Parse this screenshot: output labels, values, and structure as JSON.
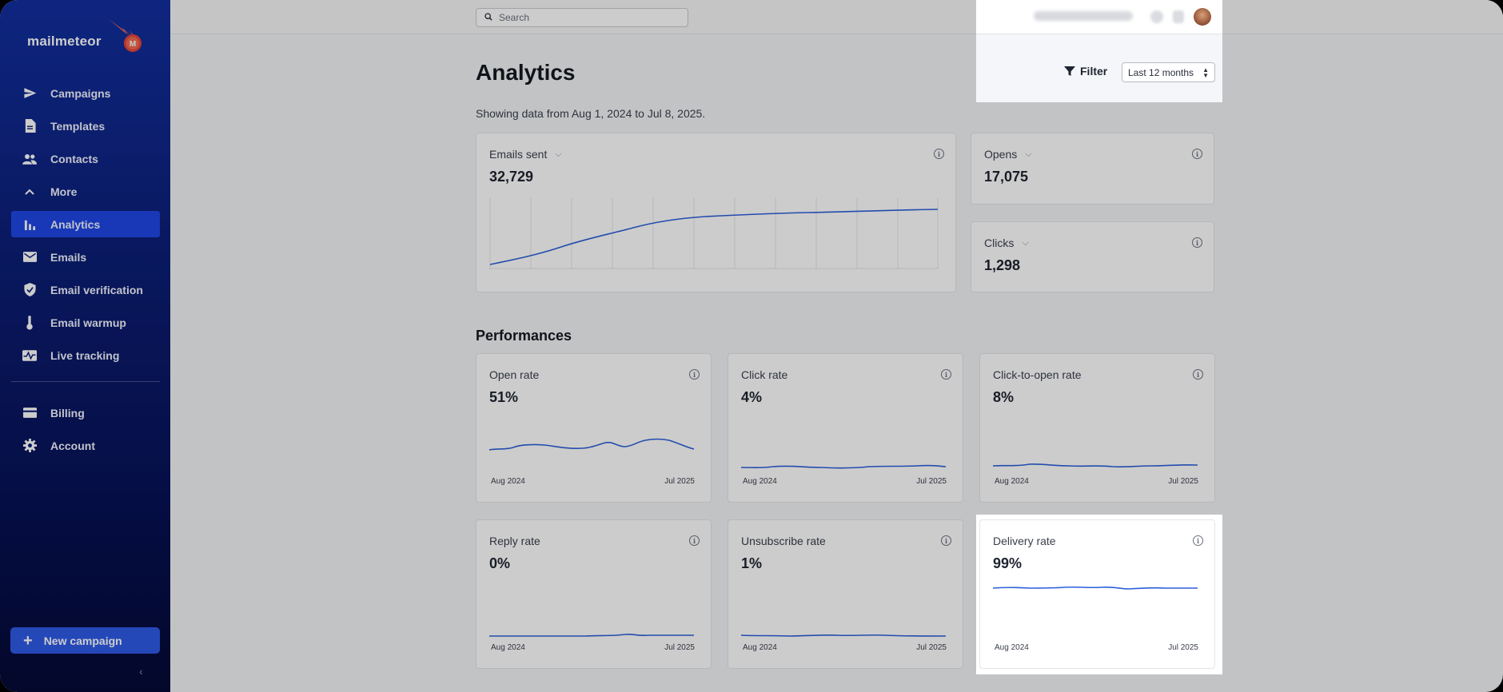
{
  "sidebar": {
    "logo_text": "mailmeteor",
    "nav": [
      {
        "label": "Campaigns",
        "icon": "send-icon"
      },
      {
        "label": "Templates",
        "icon": "document-icon"
      },
      {
        "label": "Contacts",
        "icon": "people-icon"
      },
      {
        "label": "More",
        "icon": "chevron-up-icon"
      },
      {
        "label": "Analytics",
        "icon": "bar-chart-icon",
        "active": true
      },
      {
        "label": "Emails",
        "icon": "mail-icon"
      },
      {
        "label": "Email verification",
        "icon": "shield-check-icon"
      },
      {
        "label": "Email warmup",
        "icon": "thermometer-icon"
      },
      {
        "label": "Live tracking",
        "icon": "pulse-icon"
      }
    ],
    "nav_bottom": [
      {
        "label": "Billing",
        "icon": "credit-card-icon"
      },
      {
        "label": "Account",
        "icon": "gear-icon"
      }
    ],
    "new_campaign_label": "New campaign",
    "collapse_glyph": "‹"
  },
  "topbar": {
    "search_placeholder": "Search"
  },
  "page": {
    "title": "Analytics",
    "subtitle": "Showing data from Aug 1, 2024 to Jul 8, 2025.",
    "filter_label": "Filter",
    "period_selected": "Last 12 months"
  },
  "summary": {
    "emails_sent": {
      "label": "Emails sent",
      "value": "32,729"
    },
    "opens": {
      "label": "Opens",
      "value": "17,075"
    },
    "clicks": {
      "label": "Clicks",
      "value": "1,298"
    }
  },
  "performances": {
    "title": "Performances",
    "axis_start": "Aug 2024",
    "axis_end": "Jul 2025",
    "cards": [
      {
        "label": "Open rate",
        "value": "51%"
      },
      {
        "label": "Click rate",
        "value": "4%"
      },
      {
        "label": "Click-to-open rate",
        "value": "8%"
      },
      {
        "label": "Reply rate",
        "value": "0%"
      },
      {
        "label": "Unsubscribe rate",
        "value": "1%"
      },
      {
        "label": "Delivery rate",
        "value": "99%"
      }
    ]
  },
  "colors": {
    "accent": "#1f47e6",
    "line": "#2b5fd9",
    "sidebar_top": "#122fa0",
    "sidebar_bottom": "#040a36"
  }
}
